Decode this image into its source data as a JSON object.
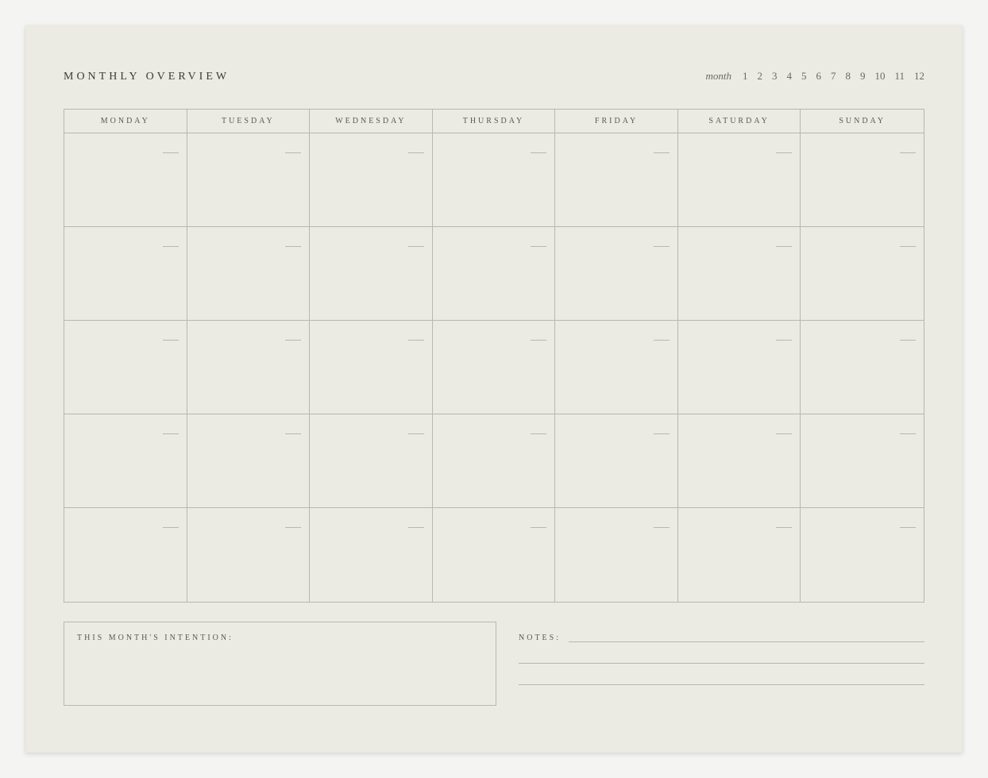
{
  "header": {
    "title": "MONTHLY OVERVIEW",
    "month_label": "month",
    "months": [
      "1",
      "2",
      "3",
      "4",
      "5",
      "6",
      "7",
      "8",
      "9",
      "10",
      "11",
      "12"
    ]
  },
  "days": [
    "MONDAY",
    "TUESDAY",
    "WEDNESDAY",
    "THURSDAY",
    "FRIDAY",
    "SATURDAY",
    "SUNDAY"
  ],
  "footer": {
    "intention_label": "THIS MONTH'S INTENTION:",
    "notes_label": "NOTES:"
  }
}
